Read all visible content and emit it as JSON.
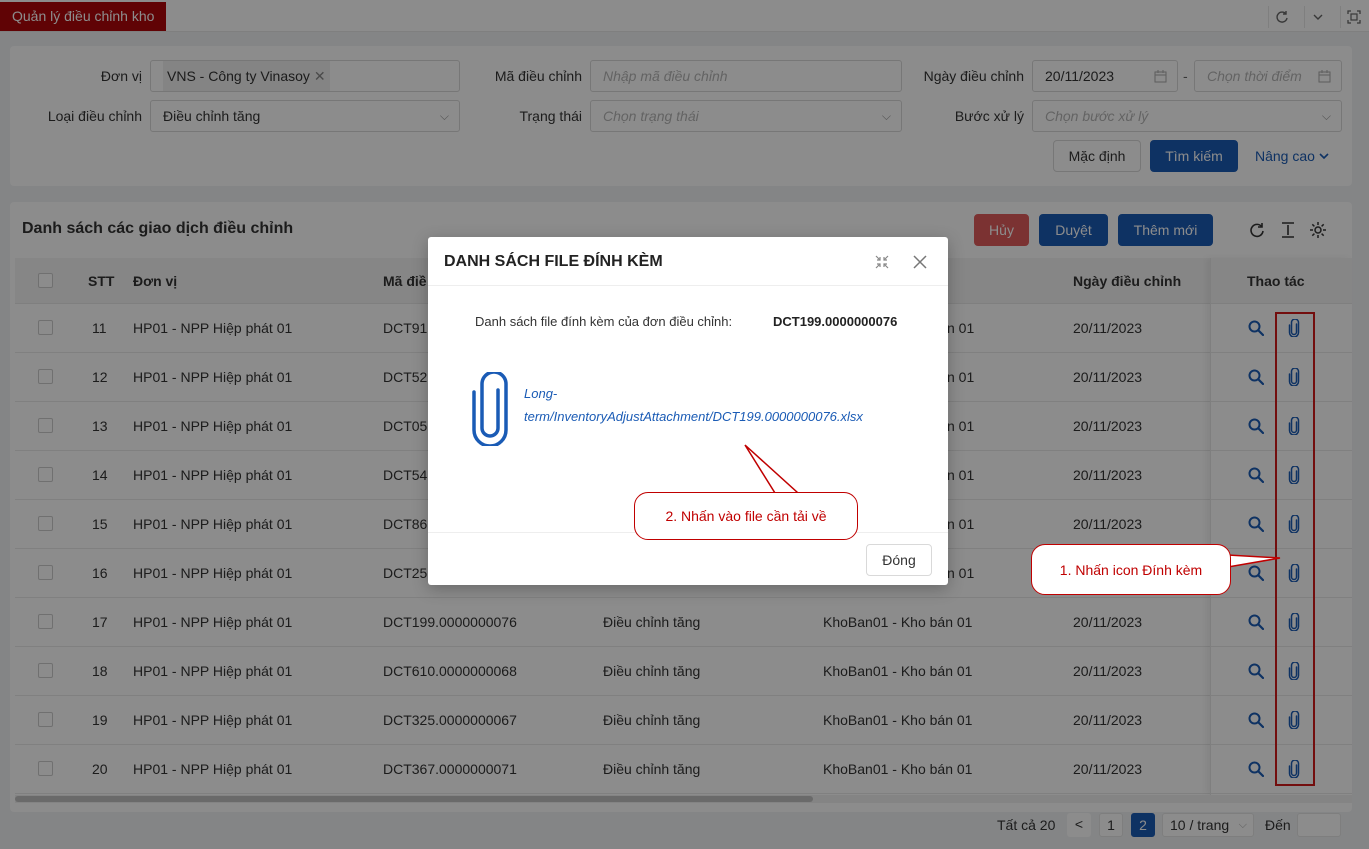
{
  "tab": {
    "label": "Quản lý điều chỉnh kho"
  },
  "topbar_icons": [
    "refresh-icon",
    "chevron-down-icon",
    "fullscreen-icon"
  ],
  "filter": {
    "don_vi_label": "Đơn vị",
    "don_vi_value": "VNS - Công ty Vinasoy",
    "ma_dc_label": "Mã điều chỉnh",
    "ma_dc_placeholder": "Nhập mã điều chỉnh",
    "ngay_label": "Ngày điều chỉnh",
    "ngay_from": "20/11/2023",
    "ngay_sep": "-",
    "ngay_to_placeholder": "Chọn thời điểm",
    "loai_label": "Loại điều chỉnh",
    "loai_value": "Điều chỉnh tăng",
    "trang_thai_label": "Trạng thái",
    "trang_thai_placeholder": "Chọn trạng thái",
    "buoc_label": "Bước xử lý",
    "buoc_placeholder": "Chọn bước xử lý",
    "default_btn": "Mặc định",
    "search_btn": "Tìm kiếm",
    "advanced_link": "Nâng cao"
  },
  "list": {
    "title": "Danh sách các giao dịch điều chỉnh",
    "cancel_btn": "Hủy",
    "approve_btn": "Duyệt",
    "add_btn": "Thêm mới",
    "headers": {
      "stt": "STT",
      "don_vi": "Đơn vị",
      "ma": "Mã điề",
      "ngay": "Ngày điều chỉnh",
      "thao_tac": "Thao tác"
    },
    "rows": [
      {
        "stt": "11",
        "don_vi": "HP01 - NPP Hiệp phát 01",
        "ma": "DCT91",
        "loai": "",
        "kho": "n 01",
        "ngay": "20/11/2023"
      },
      {
        "stt": "12",
        "don_vi": "HP01 - NPP Hiệp phát 01",
        "ma": "DCT52",
        "loai": "",
        "kho": "n 01",
        "ngay": "20/11/2023"
      },
      {
        "stt": "13",
        "don_vi": "HP01 - NPP Hiệp phát 01",
        "ma": "DCT05",
        "loai": "",
        "kho": "n 01",
        "ngay": "20/11/2023"
      },
      {
        "stt": "14",
        "don_vi": "HP01 - NPP Hiệp phát 01",
        "ma": "DCT54",
        "loai": "",
        "kho": "n 01",
        "ngay": "20/11/2023"
      },
      {
        "stt": "15",
        "don_vi": "HP01 - NPP Hiệp phát 01",
        "ma": "DCT86",
        "loai": "",
        "kho": "n 01",
        "ngay": "20/11/2023"
      },
      {
        "stt": "16",
        "don_vi": "HP01 - NPP Hiệp phát 01",
        "ma": "DCT25",
        "loai": "",
        "kho": "n 01",
        "ngay": "20/11/2023"
      },
      {
        "stt": "17",
        "don_vi": "HP01 - NPP Hiệp phát 01",
        "ma": "DCT199.0000000076",
        "loai": "Điều chỉnh tăng",
        "kho": "KhoBan01 - Kho bán 01",
        "ngay": "20/11/2023"
      },
      {
        "stt": "18",
        "don_vi": "HP01 - NPP Hiệp phát 01",
        "ma": "DCT610.0000000068",
        "loai": "Điều chỉnh tăng",
        "kho": "KhoBan01 - Kho bán 01",
        "ngay": "20/11/2023"
      },
      {
        "stt": "19",
        "don_vi": "HP01 - NPP Hiệp phát 01",
        "ma": "DCT325.0000000067",
        "loai": "Điều chỉnh tăng",
        "kho": "KhoBan01 - Kho bán 01",
        "ngay": "20/11/2023"
      },
      {
        "stt": "20",
        "don_vi": "HP01 - NPP Hiệp phát 01",
        "ma": "DCT367.0000000071",
        "loai": "Điều chỉnh tăng",
        "kho": "KhoBan01 - Kho bán 01",
        "ngay": "20/11/2023"
      }
    ]
  },
  "pagination": {
    "total": "Tất cả 20",
    "prev": "<",
    "page1": "1",
    "page2": "2",
    "per_page": "10 / trang",
    "goto_label": "Đến"
  },
  "modal": {
    "title": "DANH SÁCH FILE ĐÍNH KÈM",
    "desc": "Danh sách file đính kèm của đơn điều chỉnh:",
    "code": "DCT199.0000000076",
    "file_line1": "Long-",
    "file_line2": "term/InventoryAdjustAttachment/DCT199.0000000076.xlsx",
    "close_btn": "Đóng"
  },
  "annotations": {
    "step1": "1. Nhấn icon Đính kèm",
    "step2": "2. Nhấn vào file cần tải về"
  },
  "colors": {
    "accent": "#1a5bb5",
    "tab": "#b0070a",
    "danger": "#e05b5b",
    "callout": "#c00000"
  }
}
